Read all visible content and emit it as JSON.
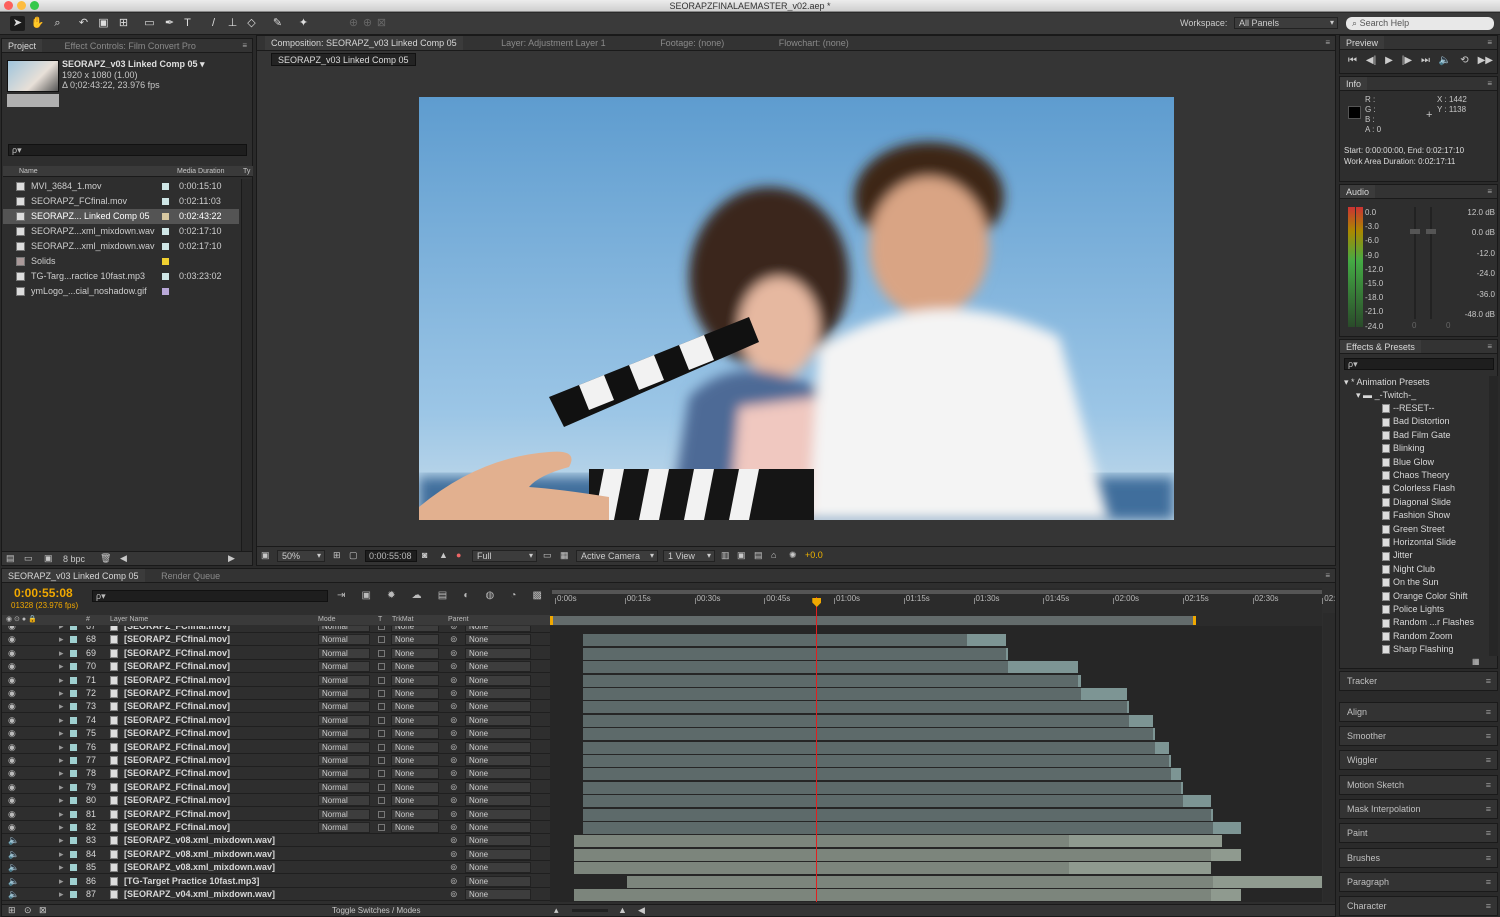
{
  "window": {
    "title": "SEORAPZFINALAEMASTER_v02.aep *"
  },
  "toolbar": {
    "workspace_label": "Workspace:",
    "workspace_value": "All Panels",
    "search_placeholder": "Search Help"
  },
  "project": {
    "tabs": [
      "Project",
      "Effect Controls: Film Convert Pro"
    ],
    "comp_name": "SEORAPZ_v03 Linked Comp 05 ▾",
    "comp_res": "1920 x 1080 (1.00)",
    "comp_dur": "Δ 0;02:43:22, 23.976 fps",
    "search_placeholder": "ρ▾",
    "col_name": "Name",
    "col_dur": "Media Duration",
    "col_type": "Ty",
    "items": [
      {
        "name": "MVI_3684_1.mov",
        "dur": "0:00:15:10",
        "color": "#cfe6e6",
        "sel": false
      },
      {
        "name": "SEORAPZ_FCfinal.mov",
        "dur": "0:02:11:03",
        "color": "#cfe6e6",
        "sel": false
      },
      {
        "name": "SEORAPZ... Linked Comp 05",
        "dur": "0:02:43:22",
        "color": "#d8c8a0",
        "sel": true
      },
      {
        "name": "SEORAPZ...xml_mixdown.wav",
        "dur": "0:02:17:10",
        "color": "#cfe6e6",
        "sel": false
      },
      {
        "name": "SEORAPZ...xml_mixdown.wav",
        "dur": "0:02:17:10",
        "color": "#cfe6e6",
        "sel": false
      },
      {
        "name": "Solids",
        "dur": "",
        "color": "#f0d030",
        "sel": false
      },
      {
        "name": "TG-Targ...ractice 10fast.mp3",
        "dur": "0:03:23:02",
        "color": "#cfe6e6",
        "sel": false
      },
      {
        "name": "ymLogo_...cial_noshadow.gif",
        "dur": "",
        "color": "#b9a8d8",
        "sel": false
      }
    ],
    "bpc": "8 bpc"
  },
  "viewer": {
    "tabs": [
      "Composition: SEORAPZ_v03 Linked Comp 05",
      "Layer: Adjustment Layer 1",
      "Footage: (none)",
      "Flowchart: (none)"
    ],
    "comp_subtab": "SEORAPZ_v03 Linked Comp 05",
    "zoom": "50%",
    "timecode": "0:00:55:08",
    "resolution": "Full",
    "camera": "Active Camera",
    "views": "1 View",
    "exposure": "+0.0"
  },
  "preview": {
    "title": "Preview"
  },
  "info": {
    "title": "Info",
    "r": "R :",
    "g": "G :",
    "b": "B :",
    "a": "A : 0",
    "x": "X : 1442",
    "y": "Y : 1138",
    "start_end": "Start: 0:00:00:00, End: 0:02:17:10",
    "work_area": "Work Area Duration: 0:02:17:11"
  },
  "audio": {
    "title": "Audio",
    "left_labels": [
      "0.0",
      "-3.0",
      "-6.0",
      "-9.0",
      "-12.0",
      "-15.0",
      "-18.0",
      "-21.0",
      "-24.0"
    ],
    "right_labels": [
      "12.0 dB",
      "0.0 dB",
      "-12.0",
      "-24.0",
      "-36.0",
      "-48.0 dB"
    ],
    "zero_l": "0",
    "zero_r": "0"
  },
  "effects": {
    "title": "Effects & Presets",
    "search_placeholder": "ρ▾",
    "root": "* Animation Presets",
    "folder": "_-Twitch-_",
    "presets": [
      "--RESET--",
      "Bad Distortion",
      "Bad Film Gate",
      "Blinking",
      "Blue Glow",
      "Chaos Theory",
      "Colorless Flash",
      "Diagonal Slide",
      "Fashion Show",
      "Green Street",
      "Horizontal Slide",
      "Jitter",
      "Night Club",
      "On the Sun",
      "Orange Color Shift",
      "Police Lights",
      "Random ...r Flashes",
      "Random Zoom",
      "Sharp Flashing"
    ]
  },
  "collapsed_panels": [
    "Tracker",
    "Align",
    "Smoother",
    "Wiggler",
    "Motion Sketch",
    "Mask Interpolation",
    "Paint",
    "Brushes",
    "Paragraph",
    "Character"
  ],
  "timeline": {
    "tabs": [
      "SEORAPZ_v03 Linked Comp 05",
      "Render Queue"
    ],
    "timecode": "0:00:55:08",
    "frames": "01328 (23.976 fps)",
    "search_placeholder": "ρ▾",
    "ruler": [
      "0:00s",
      "00:15s",
      "00:30s",
      "00:45s",
      "01:00s",
      "01:15s",
      "01:30s",
      "01:45s",
      "02:00s",
      "02:15s",
      "02:30s",
      "02:"
    ],
    "col_headers": {
      "num": "#",
      "name": "Layer Name",
      "mode": "Mode",
      "t": "T",
      "trkmat": "TrkMat",
      "parent": "Parent"
    },
    "toggle_label": "Toggle Switches / Modes",
    "layers": [
      {
        "num": "67",
        "name": "[SEORAPZ_FCfinal.mov]",
        "mode": "Normal",
        "trk": "None",
        "parent": "None",
        "start": 0.0,
        "end": 0.0,
        "s2": 0.0,
        "e2": 0.0
      },
      {
        "num": "68",
        "name": "[SEORAPZ_FCfinal.mov]",
        "mode": "Normal",
        "trk": "None",
        "parent": "None",
        "start": 0.0,
        "end": 82.5,
        "s2": 82.5,
        "e2": 91.0
      },
      {
        "num": "69",
        "name": "[SEORAPZ_FCfinal.mov]",
        "mode": "Normal",
        "trk": "None",
        "parent": "None",
        "start": 0.0,
        "end": 91.0,
        "s2": 91.0,
        "e2": 91.5
      },
      {
        "num": "70",
        "name": "[SEORAPZ_FCfinal.mov]",
        "mode": "Normal",
        "trk": "None",
        "parent": "None",
        "start": 0.0,
        "end": 91.5,
        "s2": 91.5,
        "e2": 106.5
      },
      {
        "num": "71",
        "name": "[SEORAPZ_FCfinal.mov]",
        "mode": "Normal",
        "trk": "None",
        "parent": "None",
        "start": 0.0,
        "end": 106.5,
        "s2": 106.5,
        "e2": 107.0
      },
      {
        "num": "72",
        "name": "[SEORAPZ_FCfinal.mov]",
        "mode": "Normal",
        "trk": "None",
        "parent": "None",
        "start": 0.0,
        "end": 107.0,
        "s2": 107.0,
        "e2": 117.0
      },
      {
        "num": "73",
        "name": "[SEORAPZ_FCfinal.mov]",
        "mode": "Normal",
        "trk": "None",
        "parent": "None",
        "start": 0.0,
        "end": 117.0,
        "s2": 117.0,
        "e2": 117.5
      },
      {
        "num": "74",
        "name": "[SEORAPZ_FCfinal.mov]",
        "mode": "Normal",
        "trk": "None",
        "parent": "None",
        "start": 0.0,
        "end": 117.5,
        "s2": 117.5,
        "e2": 122.5
      },
      {
        "num": "75",
        "name": "[SEORAPZ_FCfinal.mov]",
        "mode": "Normal",
        "trk": "None",
        "parent": "None",
        "start": 0.0,
        "end": 122.5,
        "s2": 122.5,
        "e2": 123.0
      },
      {
        "num": "76",
        "name": "[SEORAPZ_FCfinal.mov]",
        "mode": "Normal",
        "trk": "None",
        "parent": "None",
        "start": 0.0,
        "end": 123.0,
        "s2": 123.0,
        "e2": 126.0
      },
      {
        "num": "77",
        "name": "[SEORAPZ_FCfinal.mov]",
        "mode": "Normal",
        "trk": "None",
        "parent": "None",
        "start": 0.0,
        "end": 126.0,
        "s2": 126.0,
        "e2": 126.5
      },
      {
        "num": "78",
        "name": "[SEORAPZ_FCfinal.mov]",
        "mode": "Normal",
        "trk": "None",
        "parent": "None",
        "start": 0.0,
        "end": 126.5,
        "s2": 126.5,
        "e2": 128.5
      },
      {
        "num": "79",
        "name": "[SEORAPZ_FCfinal.mov]",
        "mode": "Normal",
        "trk": "None",
        "parent": "None",
        "start": 0.0,
        "end": 128.5,
        "s2": 128.5,
        "e2": 129.0
      },
      {
        "num": "80",
        "name": "[SEORAPZ_FCfinal.mov]",
        "mode": "Normal",
        "trk": "None",
        "parent": "None",
        "start": 0.0,
        "end": 129.0,
        "s2": 129.0,
        "e2": 135.0
      },
      {
        "num": "81",
        "name": "[SEORAPZ_FCfinal.mov]",
        "mode": "Normal",
        "trk": "None",
        "parent": "None",
        "start": 0.0,
        "end": 135.0,
        "s2": 135.0,
        "e2": 135.5
      },
      {
        "num": "82",
        "name": "[SEORAPZ_FCfinal.mov]",
        "mode": "Normal",
        "trk": "None",
        "parent": "None",
        "start": 0.0,
        "end": 135.5,
        "s2": 135.5,
        "e2": 141.5
      },
      {
        "num": "83",
        "name": "[SEORAPZ_v08.xml_mixdown.wav]",
        "mode": "",
        "trk": "",
        "parent": "None",
        "start": -2.0,
        "end": 104.5,
        "s2": 104.5,
        "e2": 137.5
      },
      {
        "num": "84",
        "name": "[SEORAPZ_v08.xml_mixdown.wav]",
        "mode": "",
        "trk": "",
        "parent": "None",
        "start": -2.0,
        "end": 135.0,
        "s2": 135.0,
        "e2": 141.5
      },
      {
        "num": "85",
        "name": "[SEORAPZ_v08.xml_mixdown.wav]",
        "mode": "",
        "trk": "",
        "parent": "None",
        "start": -2.0,
        "end": 104.5,
        "s2": 104.5,
        "e2": 135.0
      },
      {
        "num": "86",
        "name": "[TG-Target Practice 10fast.mp3]",
        "mode": "",
        "trk": "",
        "parent": "None",
        "start": 9.5,
        "end": 135.5,
        "s2": 135.5,
        "e2": 166.0
      },
      {
        "num": "87",
        "name": "[SEORAPZ_v04.xml_mixdown.wav]",
        "mode": "",
        "trk": "",
        "parent": "None",
        "start": -2.0,
        "end": 135.0,
        "s2": 135.0,
        "e2": 141.5
      }
    ]
  },
  "colors": {
    "accent": "#f0a800",
    "playhead": "#e02020",
    "bar": "#7d9594",
    "bar_dim": "#5d6a6a",
    "sky": "#6fa8d6"
  }
}
